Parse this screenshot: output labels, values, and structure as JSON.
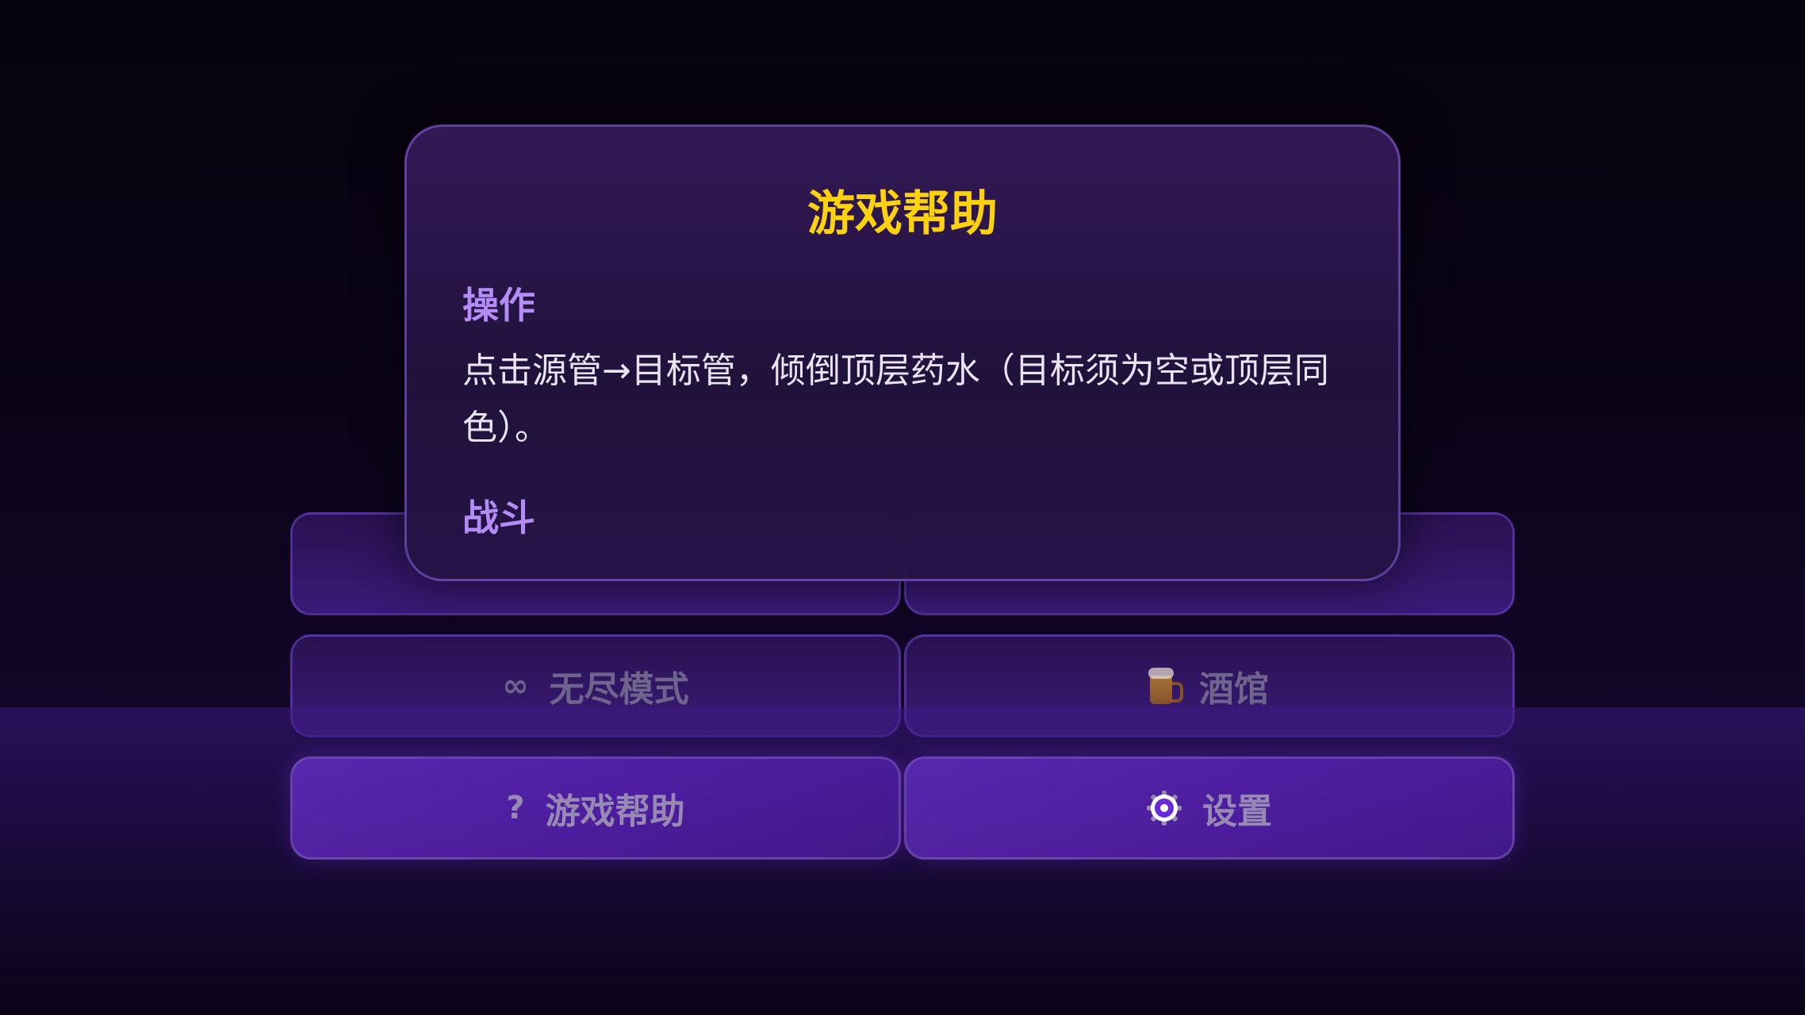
{
  "menu": {
    "row1": {
      "left": "",
      "right": ""
    },
    "endless": {
      "icon": "∞",
      "label": "无尽模式"
    },
    "tavern": {
      "icon": "beer-mug",
      "label": "酒馆"
    },
    "help": {
      "icon": "?",
      "label": "游戏帮助"
    },
    "settings": {
      "icon": "gear",
      "label": "设置"
    }
  },
  "help_modal": {
    "title": "游戏帮助",
    "sections": [
      {
        "heading": "操作",
        "text": "点击源管→目标管，倾倒顶层药水（目标须为空或顶层同色）。"
      },
      {
        "heading": "战斗",
        "text": ""
      }
    ]
  },
  "colors": {
    "title": "#fcd20e",
    "heading": "#b48cf5",
    "accent": "#7c3aed"
  }
}
